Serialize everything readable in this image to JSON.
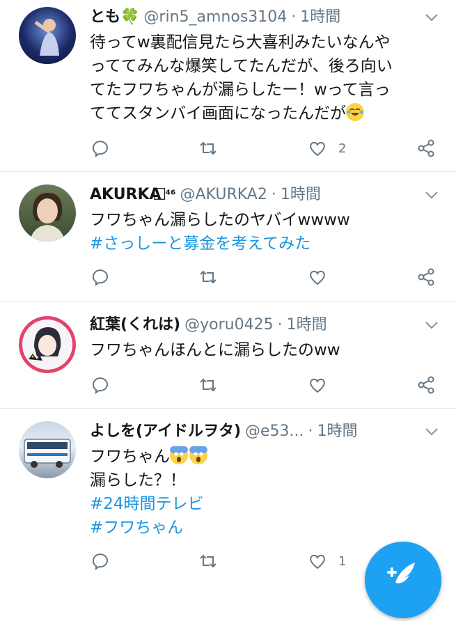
{
  "tweets": [
    {
      "name": "とも🍀",
      "handle": "@rin5_amnos3104",
      "dot": "·",
      "time": "1時間",
      "lines": [
        "待ってw裏配信見たら大喜利みたいなんや",
        "っててみんな爆笑してたんだが、後ろ向い",
        "てたフワちゃんが漏らしたー！wって言っ",
        "ててスタンバイ画面になったんだが"
      ],
      "like_count": "2",
      "avatar_icon": "stage-performer-avatar"
    },
    {
      "name": "AKURKA",
      "name_suffix": "⃞⁴⁶",
      "handle": "@AKURKA2",
      "dot": "·",
      "time": "1時間",
      "lines": [
        "フワちゃん漏らしたのヤバイwwww"
      ],
      "hashtags": [
        "#さっしーと募金を考えてみた"
      ],
      "like_count": "",
      "avatar_icon": "short-hair-person-avatar"
    },
    {
      "name": "紅葉(くれは)",
      "handle": "@yoru0425",
      "dot": "·",
      "time": "1時間",
      "lines": [
        "フワちゃんほんとに漏らしたのww"
      ],
      "like_count": "",
      "avatar_icon": "illustrated-girl-cat-avatar"
    },
    {
      "name": "よしを(アイドルヲタ)",
      "handle": "@e53...",
      "dot": "·",
      "time": "1時間",
      "lines": [
        "フワちゃん",
        "漏らした？！"
      ],
      "hashtags": [
        "#24時間テレビ",
        "#フワちゃん"
      ],
      "like_count": "1",
      "avatar_icon": "bus-photo-avatar"
    }
  ],
  "fab_icon": "compose-tweet-icon",
  "colors": {
    "hashtag": "#1b95e0",
    "muted": "#657786",
    "fab": "#1da1f2"
  }
}
